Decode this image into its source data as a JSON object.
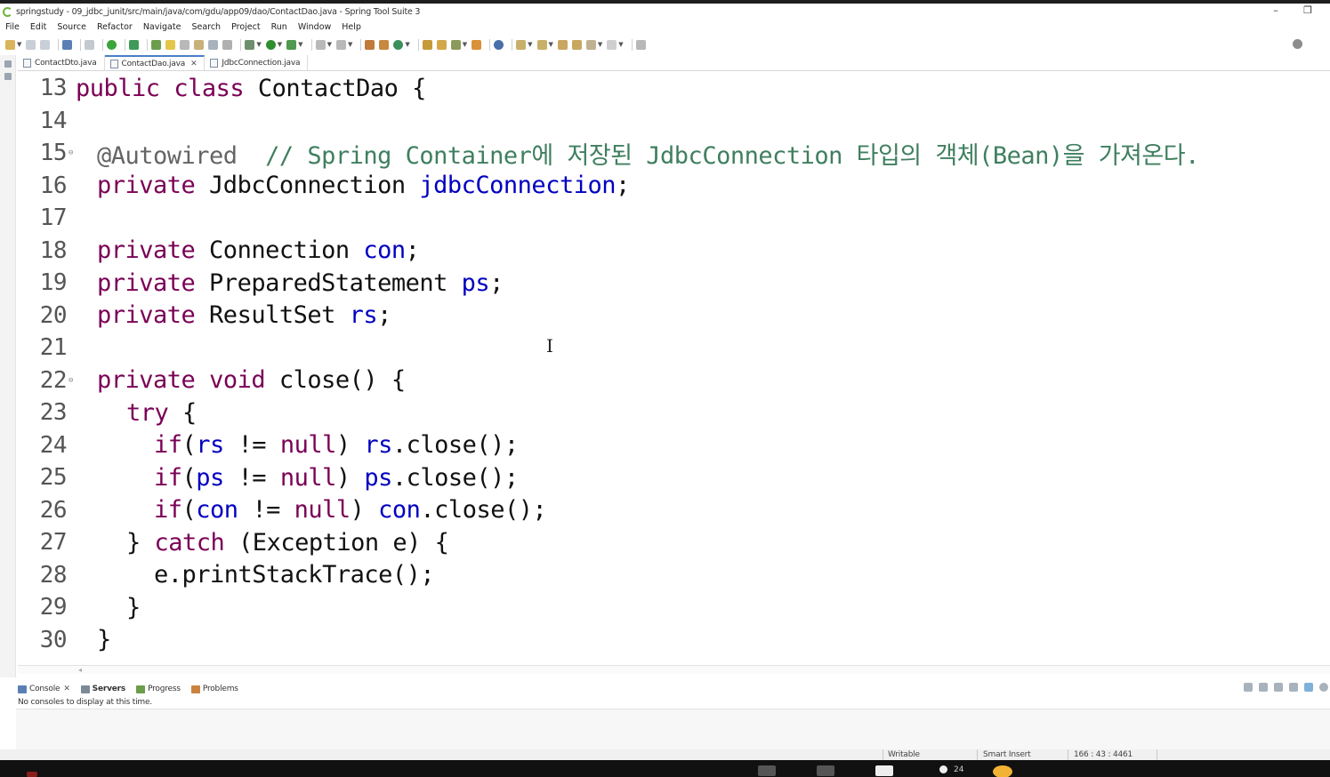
{
  "window": {
    "title": "springstudy - 09_jdbc_junit/src/main/java/com/gdu/app09/dao/ContactDao.java - Spring Tool Suite 3",
    "minimize_glyph": "–",
    "restore_glyph": "❐"
  },
  "menu": [
    "File",
    "Edit",
    "Source",
    "Refactor",
    "Navigate",
    "Search",
    "Project",
    "Run",
    "Window",
    "Help"
  ],
  "editor_tabs": [
    {
      "label": "ContactDto.java",
      "active": false
    },
    {
      "label": "ContactDao.java",
      "active": true,
      "close": "✕"
    },
    {
      "label": "JdbcConnection.java",
      "active": false
    }
  ],
  "code": {
    "lines": [
      {
        "num": "13",
        "fold": ""
      },
      {
        "num": "14",
        "fold": ""
      },
      {
        "num": "15",
        "fold": "⊖"
      },
      {
        "num": "16",
        "fold": ""
      },
      {
        "num": "17",
        "fold": ""
      },
      {
        "num": "18",
        "fold": ""
      },
      {
        "num": "19",
        "fold": ""
      },
      {
        "num": "20",
        "fold": ""
      },
      {
        "num": "21",
        "fold": ""
      },
      {
        "num": "22",
        "fold": "⊖"
      },
      {
        "num": "23",
        "fold": ""
      },
      {
        "num": "24",
        "fold": ""
      },
      {
        "num": "25",
        "fold": ""
      },
      {
        "num": "26",
        "fold": ""
      },
      {
        "num": "27",
        "fold": ""
      },
      {
        "num": "28",
        "fold": ""
      },
      {
        "num": "29",
        "fold": ""
      },
      {
        "num": "30",
        "fold": ""
      }
    ],
    "t": {
      "public": "public",
      "class": "class",
      "class_name": " ContactDao {",
      "annotation": "@Autowired",
      "comment": "  // Spring Container에 저장된 JdbcConnection 타입의 객체(Bean)을 가져온다.",
      "private": "private",
      "void": "void",
      "jdbc_type": " JdbcConnection ",
      "jdbc_field": "jdbcConnection",
      "semi": ";",
      "conn_type": " Connection ",
      "con": "con",
      "ps_type": " PreparedStatement ",
      "ps": "ps",
      "rs_type": " ResultSet ",
      "rs": "rs",
      "close_sig": " close() {",
      "try": "try",
      "brace_open": " {",
      "if": "if",
      "paren_open": "(",
      "neq": " != ",
      "null": "null",
      "paren_close": ") ",
      "close_call": ".close();",
      "brace_close": "} ",
      "catch": "catch",
      "catch_rest": " (Exception e) {",
      "print_trace": "e.printStackTrace();",
      "brace": "}"
    }
  },
  "bottom_panel": {
    "tabs": [
      {
        "label": "Console",
        "close": "✕"
      },
      {
        "label": "Servers"
      },
      {
        "label": "Progress"
      },
      {
        "label": "Problems"
      }
    ],
    "message": "No consoles to display at this time."
  },
  "status": {
    "writable": "Writable",
    "insert_mode": "Smart Insert",
    "position": "166 : 43 : 4461"
  },
  "taskbar": {
    "badge_count": "24"
  },
  "colors": {
    "keyword": "#7a0055",
    "field": "#0000c0",
    "comment": "#3f7f5f",
    "annotation": "#646464",
    "spring_green": "#6db33f"
  }
}
